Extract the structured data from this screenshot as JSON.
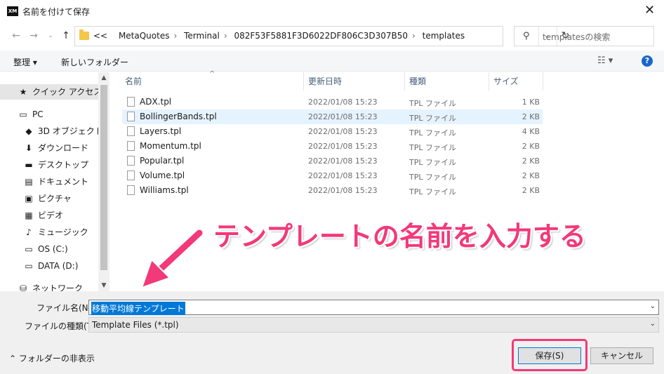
{
  "window": {
    "title": "名前を付けて保存",
    "app_icon_text": "XM"
  },
  "nav": {
    "path": [
      "MetaQuotes",
      "Terminal",
      "082F53F5881F3D6022DF806C3D307B50",
      "templates"
    ],
    "overflow": "<<",
    "search_placeholder": "templatesの検索"
  },
  "toolbar": {
    "organize": "整理 ▾",
    "new_folder": "新しいフォルダー",
    "view": "☷ ▾",
    "help": "?"
  },
  "sidebar": {
    "items": [
      {
        "label": "クイック アクセス",
        "icon": "star-icon",
        "glyph": "★",
        "color": "#1f78d1"
      },
      {
        "label": "PC",
        "icon": "pc-icon",
        "glyph": "▭",
        "color": "#1f78d1"
      },
      {
        "label": "3D オブジェクト",
        "icon": "cube-icon",
        "glyph": "◆",
        "color": "#35a5d9"
      },
      {
        "label": "ダウンロード",
        "icon": "download-icon",
        "glyph": "⬇",
        "color": "#1f78d1"
      },
      {
        "label": "デスクトップ",
        "icon": "desktop-icon",
        "glyph": "▬",
        "color": "#1f78d1"
      },
      {
        "label": "ドキュメント",
        "icon": "document-icon",
        "glyph": "▤",
        "color": "#555555"
      },
      {
        "label": "ピクチャ",
        "icon": "picture-icon",
        "glyph": "▣",
        "color": "#1f78d1"
      },
      {
        "label": "ビデオ",
        "icon": "video-icon",
        "glyph": "▦",
        "color": "#333333"
      },
      {
        "label": "ミュージック",
        "icon": "music-icon",
        "glyph": "♪",
        "color": "#1f78d1"
      },
      {
        "label": "OS (C:)",
        "icon": "drive-c-icon",
        "glyph": "▭",
        "color": "#555555"
      },
      {
        "label": "DATA (D:)",
        "icon": "drive-d-icon",
        "glyph": "▭",
        "color": "#555555"
      },
      {
        "label": "ネットワーク",
        "icon": "network-icon",
        "glyph": "⛁",
        "color": "#1f78d1"
      }
    ]
  },
  "filelist": {
    "columns": {
      "name": "名前",
      "date": "更新日時",
      "type": "種類",
      "size": "サイズ"
    },
    "files": [
      {
        "name": "ADX.tpl",
        "date": "2022/01/08 15:23",
        "type": "TPL ファイル",
        "size": "1 KB"
      },
      {
        "name": "BollingerBands.tpl",
        "date": "2022/01/08 15:23",
        "type": "TPL ファイル",
        "size": "2 KB"
      },
      {
        "name": "Layers.tpl",
        "date": "2022/01/08 15:23",
        "type": "TPL ファイル",
        "size": "4 KB"
      },
      {
        "name": "Momentum.tpl",
        "date": "2022/01/08 15:23",
        "type": "TPL ファイル",
        "size": "2 KB"
      },
      {
        "name": "Popular.tpl",
        "date": "2022/01/08 15:23",
        "type": "TPL ファイル",
        "size": "2 KB"
      },
      {
        "name": "Volume.tpl",
        "date": "2022/01/08 15:23",
        "type": "TPL ファイル",
        "size": "2 KB"
      },
      {
        "name": "Williams.tpl",
        "date": "2022/01/08 15:23",
        "type": "TPL ファイル",
        "size": "2 KB"
      }
    ]
  },
  "annotation": {
    "text": "テンプレートの名前を入力する",
    "color": "#f2397a"
  },
  "form": {
    "filename_label": "ファイル名(N):",
    "filename_value": "移動平均線テンプレート",
    "filetype_label": "ファイルの種類(T):",
    "filetype_value": "Template Files (*.tpl)",
    "hide_folders": "フォルダーの非表示",
    "save": "保存(S)",
    "cancel": "キャンセル"
  }
}
